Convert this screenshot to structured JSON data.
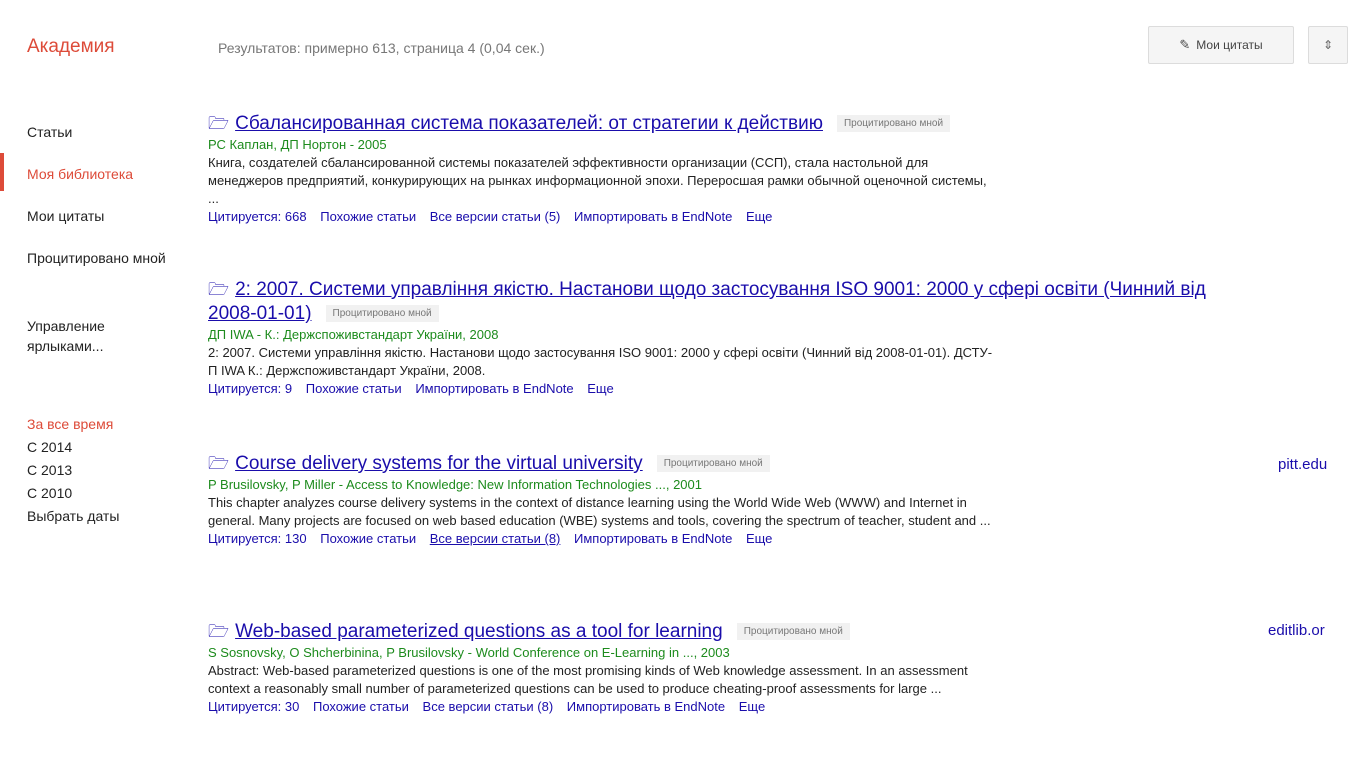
{
  "header": {
    "brand": "Академия",
    "stats": "Результатов: примерно 613, страница 4 (0,04 сек.)",
    "my_citations_btn": "Мои цитаты",
    "more_btn": "⇕"
  },
  "sidebar": {
    "items": [
      {
        "label": "Статьи"
      },
      {
        "label": "Моя библиотека"
      },
      {
        "label": "Мои цитаты"
      },
      {
        "label": "Процитировано мной"
      },
      {
        "label": "Управление ярлыками..."
      }
    ],
    "filters": [
      {
        "label": "За все время"
      },
      {
        "label": "С 2014"
      },
      {
        "label": "С 2013"
      },
      {
        "label": "С 2010"
      },
      {
        "label": "Выбрать даты"
      }
    ]
  },
  "results": [
    {
      "title": "Сбалансированная система показателей: от стратегии к действию",
      "tag": "Процитировано мной",
      "authors": "РС Каплан, ДП Нортон - 2005",
      "snippet": "Книга, создателей сбалансированной системы показателей эффективности организации (ССП), стала настольной для менеджеров предприятий, конкурирующих на рынках информационной эпохи. Переросшая рамки обычной оценочной системы, ...",
      "links": [
        "Цитируется: 668",
        "Похожие статьи",
        "Все версии статьи (5)",
        "Импортировать в EndNote",
        "Еще"
      ]
    },
    {
      "title": "2: 2007. Системи управління якістю. Настанови щодо застосування ISO 9001: 2000 у сфері освіти (Чинний від 2008-01-01)",
      "tag": "Процитировано мной",
      "authors": "ДП IWA - К.: Держспоживстандарт України, 2008",
      "snippet": "2: 2007. Системи управління якістю. Настанови щодо застосування ISO 9001: 2000 у сфері освіти (Чинний від 2008-01-01). ДСТУ-П IWA К.: Держспоживстандарт України, 2008.",
      "links": [
        "Цитируется: 9",
        "Похожие статьи",
        "Импортировать в EndNote",
        "Еще"
      ]
    },
    {
      "title": "Course delivery systems for the virtual university",
      "tag": "Процитировано мной",
      "authors": "P Brusilovsky, P Miller - Access to Knowledge: New Information Technologies ..., 2001",
      "snippet": "This chapter analyzes course delivery systems in the context of distance learning using the World Wide Web (WWW) and Internet in general. Many projects are focused on web based education (WBE) systems and tools, covering the spectrum of teacher, student and ...",
      "links": [
        "Цитируется: 130",
        "Похожие статьи",
        "Все версии статьи (8)",
        "Импортировать в EndNote",
        "Еще"
      ],
      "domain": "pitt.edu"
    },
    {
      "title": "Web-based parameterized questions as a tool for learning",
      "tag": "Процитировано мной",
      "authors": "S Sosnovsky, O Shcherbinina, P Brusilovsky - World Conference on E-Learning in ..., 2003",
      "snippet": "Abstract: Web-based parameterized questions is one of the most promising kinds of Web knowledge assessment. In an assessment context a reasonably small number of parameterized questions can be used to produce cheating-proof assessments for large ...",
      "links": [
        "Цитируется: 30",
        "Похожие статьи",
        "Все версии статьи (8)",
        "Импортировать в EndNote",
        "Еще"
      ],
      "domain": "editlib.or"
    }
  ],
  "colors": {
    "brand": "#dd4b39",
    "link": "#1a0dab",
    "authors": "#1d8b1d"
  }
}
